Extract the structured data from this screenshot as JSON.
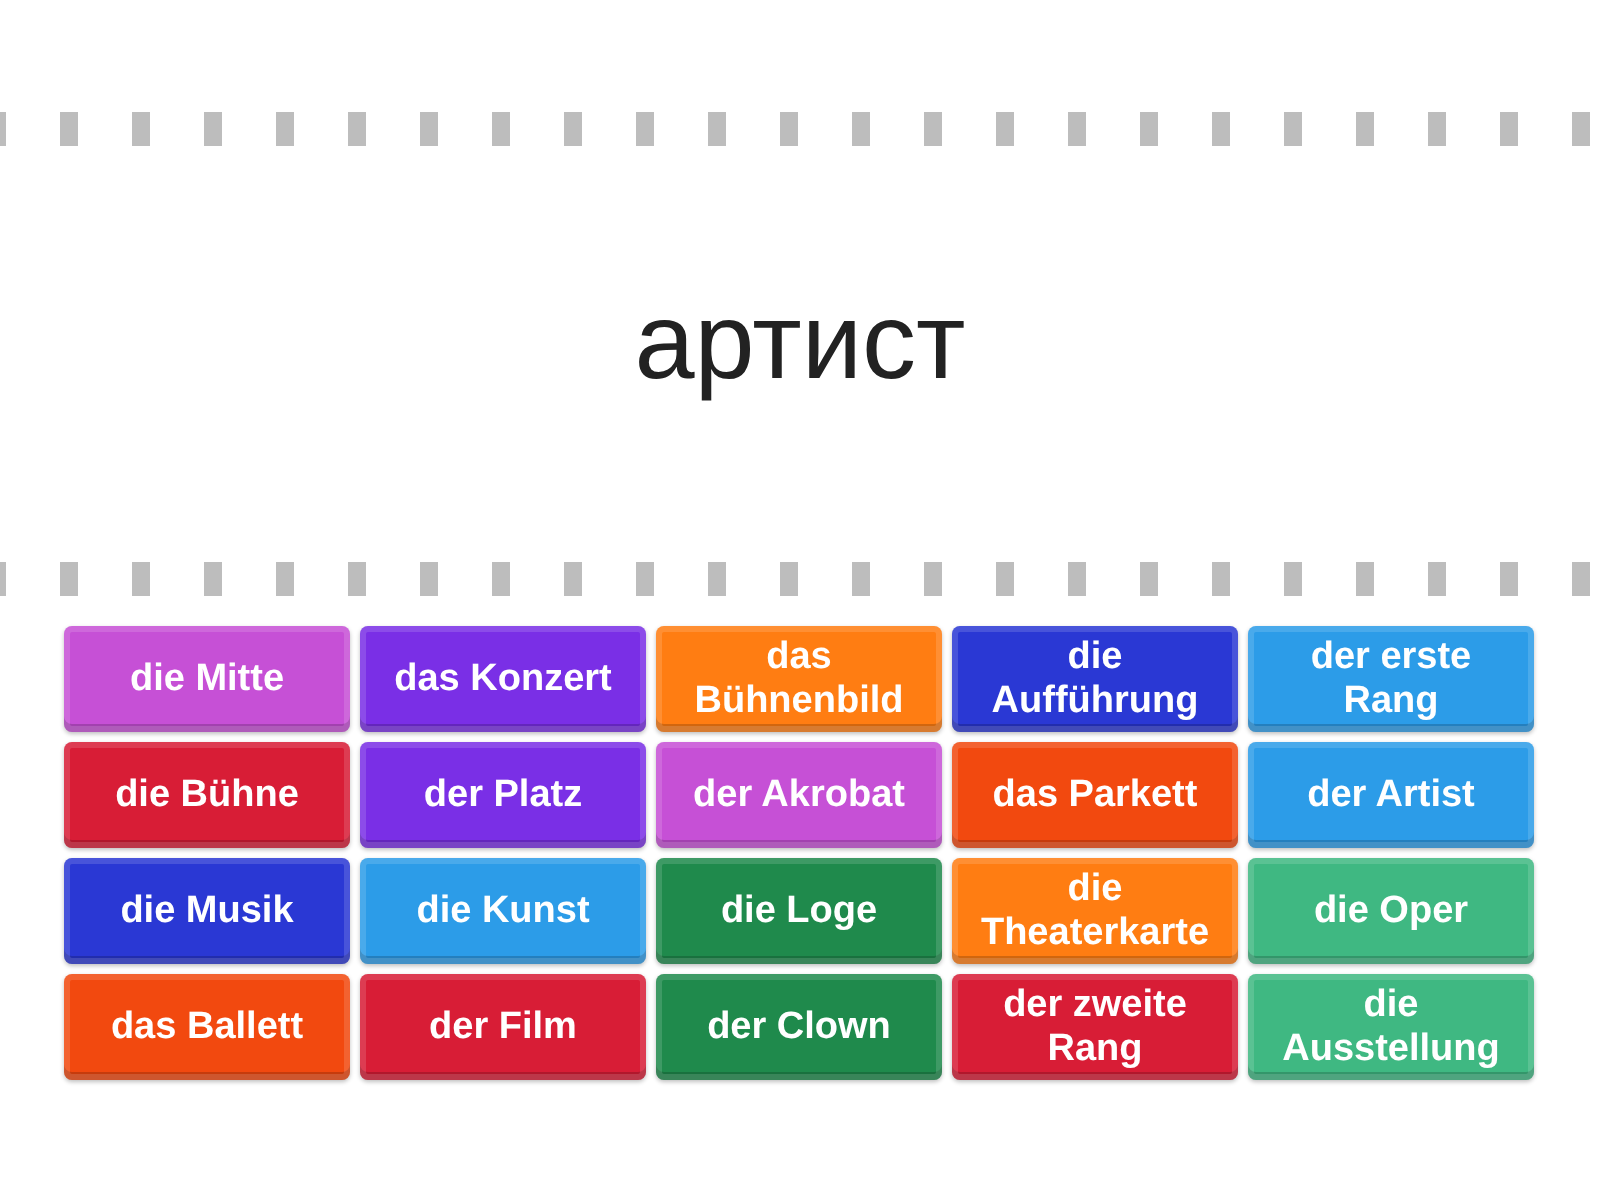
{
  "prompt": {
    "text": "артист"
  },
  "tiles": [
    {
      "label": "die Mitte",
      "color": "#c650d6"
    },
    {
      "label": "das Konzert",
      "color": "#7a2fe6"
    },
    {
      "label": "das Bühnenbild",
      "color": "#ff7d12"
    },
    {
      "label": "die Aufführung",
      "color": "#2a38d4"
    },
    {
      "label": "der erste Rang",
      "color": "#2c9ce8"
    },
    {
      "label": "die Bühne",
      "color": "#d81d36"
    },
    {
      "label": "der Platz",
      "color": "#7a2fe6"
    },
    {
      "label": "der Akrobat",
      "color": "#c650d6"
    },
    {
      "label": "das Parkett",
      "color": "#f2490f"
    },
    {
      "label": "der Artist",
      "color": "#2c9ce8"
    },
    {
      "label": "die Musik",
      "color": "#2a38d4"
    },
    {
      "label": "die Kunst",
      "color": "#2c9ce8"
    },
    {
      "label": "die Loge",
      "color": "#1f8a4c"
    },
    {
      "label": "die Theaterkarte",
      "color": "#ff7d12"
    },
    {
      "label": "die Oper",
      "color": "#3fb882"
    },
    {
      "label": "das Ballett",
      "color": "#f2490f"
    },
    {
      "label": "der Film",
      "color": "#d81d36"
    },
    {
      "label": "der Clown",
      "color": "#1f8a4c"
    },
    {
      "label": "der zweite Rang",
      "color": "#d81d36"
    },
    {
      "label": "die Ausstellung",
      "color": "#3fb882"
    }
  ]
}
